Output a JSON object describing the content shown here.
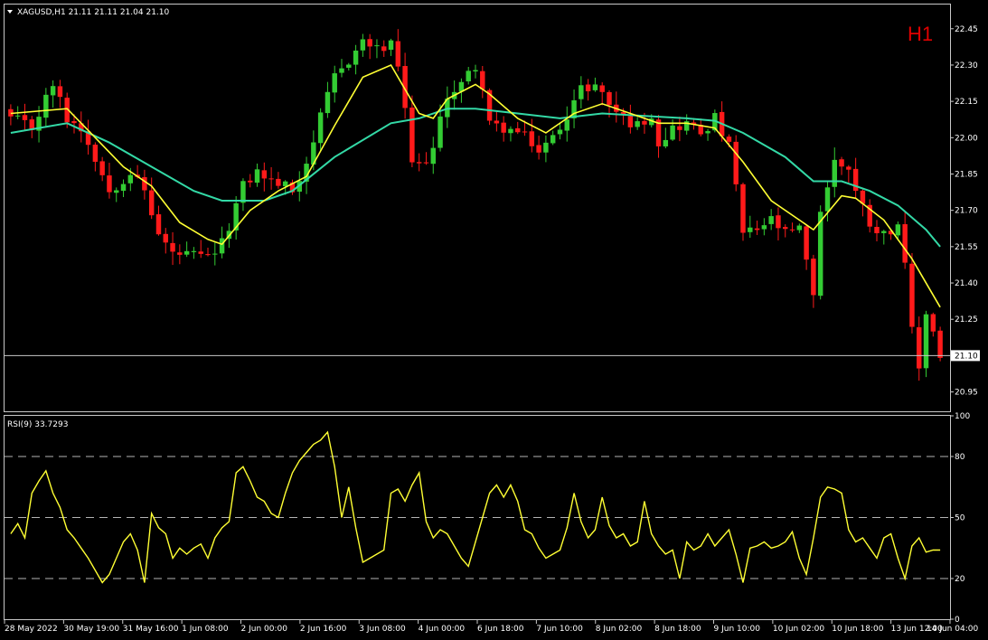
{
  "header": {
    "symbol_info": "XAGUSD,H1  21.11 21.11 21.04 21.10",
    "timeframe": "H1",
    "rsi_label": "RSI(9) 33.7293"
  },
  "colors": {
    "background": "#000000",
    "frame": "#c8c8c8",
    "bull_candle": "#33cc33",
    "bear_candle": "#ff1a1a",
    "ma_fast": "#ffff33",
    "ma_slow": "#33d9a6",
    "rsi": "#ffff33",
    "timeframe_label": "#e00000"
  },
  "price_tag": "21.10",
  "chart_data": [
    {
      "type": "candlestick",
      "title": "XAGUSD,H1",
      "ylim": [
        20.87,
        22.55
      ],
      "y_ticks": [
        "22.45",
        "22.30",
        "22.15",
        "22.00",
        "21.85",
        "21.70",
        "21.55",
        "21.40",
        "21.25",
        "21.10",
        "20.95"
      ],
      "x_ticks": [
        "28 May 2022",
        "30 May 19:00",
        "31 May 16:00",
        "1 Jun 08:00",
        "2 Jun 00:00",
        "2 Jun 16:00",
        "3 Jun 08:00",
        "4 Jun 00:00",
        "6 Jun 18:00",
        "7 Jun 10:00",
        "8 Jun 02:00",
        "8 Jun 18:00",
        "9 Jun 10:00",
        "10 Jun 02:00",
        "10 Jun 18:00",
        "13 Jun 12:00",
        "14 Jun 04:00"
      ],
      "last_price": 21.1,
      "close_path": [
        [
          0,
          22.08
        ],
        [
          3,
          22.04
        ],
        [
          6,
          22.22
        ],
        [
          8,
          22.08
        ],
        [
          10,
          22.04
        ],
        [
          12,
          21.92
        ],
        [
          14,
          21.78
        ],
        [
          17,
          21.86
        ],
        [
          19,
          21.78
        ],
        [
          21,
          21.6
        ],
        [
          23,
          21.52
        ],
        [
          26,
          21.51
        ],
        [
          28,
          21.5
        ],
        [
          30,
          21.56
        ],
        [
          33,
          21.8
        ],
        [
          35,
          21.86
        ],
        [
          37,
          21.82
        ],
        [
          39,
          21.8
        ],
        [
          40,
          21.78
        ],
        [
          42,
          21.9
        ],
        [
          44,
          22.08
        ],
        [
          46,
          22.25
        ],
        [
          48,
          22.32
        ],
        [
          50,
          22.4
        ],
        [
          52,
          22.36
        ],
        [
          54,
          22.38
        ],
        [
          55,
          22.3
        ],
        [
          56,
          22.1
        ],
        [
          57,
          21.9
        ],
        [
          58,
          21.88
        ],
        [
          60,
          21.95
        ],
        [
          62,
          22.18
        ],
        [
          64,
          22.22
        ],
        [
          66,
          22.3
        ],
        [
          67,
          22.2
        ],
        [
          68,
          22.05
        ],
        [
          70,
          22.04
        ],
        [
          72,
          22.02
        ],
        [
          74,
          21.98
        ],
        [
          75,
          21.94
        ],
        [
          77,
          22.0
        ],
        [
          79,
          22.1
        ],
        [
          81,
          22.2
        ],
        [
          83,
          22.22
        ],
        [
          85,
          22.14
        ],
        [
          87,
          22.08
        ],
        [
          89,
          22.05
        ],
        [
          91,
          22.1
        ],
        [
          92,
          21.98
        ],
        [
          94,
          22.04
        ],
        [
          96,
          22.06
        ],
        [
          98,
          22.02
        ],
        [
          100,
          22.08
        ],
        [
          102,
          21.96
        ],
        [
          103,
          21.8
        ],
        [
          104,
          21.6
        ],
        [
          106,
          21.62
        ],
        [
          108,
          21.66
        ],
        [
          110,
          21.6
        ],
        [
          112,
          21.62
        ],
        [
          113,
          21.48
        ],
        [
          114,
          21.36
        ],
        [
          115,
          21.7
        ],
        [
          117,
          21.9
        ],
        [
          119,
          21.88
        ],
        [
          120,
          21.78
        ],
        [
          122,
          21.65
        ],
        [
          124,
          21.6
        ],
        [
          126,
          21.65
        ],
        [
          127,
          21.46
        ],
        [
          128,
          21.2
        ],
        [
          129,
          21.05
        ],
        [
          130,
          21.28
        ],
        [
          131,
          21.2
        ],
        [
          132,
          21.1
        ]
      ],
      "ma_fast": [
        [
          0,
          22.1
        ],
        [
          8,
          22.12
        ],
        [
          12,
          22.0
        ],
        [
          16,
          21.88
        ],
        [
          20,
          21.8
        ],
        [
          24,
          21.65
        ],
        [
          28,
          21.58
        ],
        [
          30,
          21.56
        ],
        [
          34,
          21.7
        ],
        [
          38,
          21.78
        ],
        [
          42,
          21.84
        ],
        [
          46,
          22.05
        ],
        [
          50,
          22.25
        ],
        [
          54,
          22.3
        ],
        [
          56,
          22.2
        ],
        [
          58,
          22.1
        ],
        [
          60,
          22.08
        ],
        [
          62,
          22.16
        ],
        [
          66,
          22.22
        ],
        [
          68,
          22.18
        ],
        [
          72,
          22.08
        ],
        [
          76,
          22.02
        ],
        [
          80,
          22.1
        ],
        [
          84,
          22.14
        ],
        [
          88,
          22.1
        ],
        [
          92,
          22.06
        ],
        [
          96,
          22.06
        ],
        [
          100,
          22.04
        ],
        [
          104,
          21.9
        ],
        [
          108,
          21.74
        ],
        [
          112,
          21.66
        ],
        [
          114,
          21.62
        ],
        [
          118,
          21.76
        ],
        [
          120,
          21.75
        ],
        [
          124,
          21.66
        ],
        [
          128,
          21.5
        ],
        [
          132,
          21.3
        ]
      ],
      "ma_slow": [
        [
          0,
          22.02
        ],
        [
          8,
          22.06
        ],
        [
          14,
          21.98
        ],
        [
          20,
          21.88
        ],
        [
          26,
          21.78
        ],
        [
          30,
          21.74
        ],
        [
          36,
          21.74
        ],
        [
          40,
          21.78
        ],
        [
          46,
          21.92
        ],
        [
          54,
          22.06
        ],
        [
          58,
          22.08
        ],
        [
          62,
          22.12
        ],
        [
          66,
          22.12
        ],
        [
          72,
          22.1
        ],
        [
          78,
          22.08
        ],
        [
          84,
          22.1
        ],
        [
          90,
          22.09
        ],
        [
          96,
          22.08
        ],
        [
          100,
          22.07
        ],
        [
          104,
          22.02
        ],
        [
          110,
          21.92
        ],
        [
          114,
          21.82
        ],
        [
          118,
          21.82
        ],
        [
          122,
          21.78
        ],
        [
          126,
          21.72
        ],
        [
          130,
          21.62
        ],
        [
          132,
          21.55
        ]
      ]
    },
    {
      "type": "line",
      "title": "RSI(9) 33.7293",
      "ylim": [
        0,
        100
      ],
      "y_ticks": [
        100,
        80,
        50,
        20,
        0
      ],
      "levels": [
        80,
        50,
        20
      ],
      "series": [
        {
          "name": "RSI(9)",
          "values": [
            [
              0,
              42
            ],
            [
              1,
              47
            ],
            [
              2,
              40
            ],
            [
              3,
              62
            ],
            [
              4,
              68
            ],
            [
              5,
              73
            ],
            [
              6,
              62
            ],
            [
              7,
              55
            ],
            [
              8,
              44
            ],
            [
              9,
              40
            ],
            [
              10,
              35
            ],
            [
              11,
              30
            ],
            [
              12,
              24
            ],
            [
              13,
              18
            ],
            [
              14,
              22
            ],
            [
              15,
              30
            ],
            [
              16,
              38
            ],
            [
              17,
              42
            ],
            [
              18,
              34
            ],
            [
              19,
              18
            ],
            [
              20,
              52
            ],
            [
              21,
              45
            ],
            [
              22,
              42
            ],
            [
              23,
              30
            ],
            [
              24,
              35
            ],
            [
              25,
              32
            ],
            [
              26,
              35
            ],
            [
              27,
              37
            ],
            [
              28,
              30
            ],
            [
              29,
              40
            ],
            [
              30,
              45
            ],
            [
              31,
              48
            ],
            [
              32,
              72
            ],
            [
              33,
              75
            ],
            [
              34,
              68
            ],
            [
              35,
              60
            ],
            [
              36,
              58
            ],
            [
              37,
              52
            ],
            [
              38,
              50
            ],
            [
              39,
              62
            ],
            [
              40,
              72
            ],
            [
              41,
              78
            ],
            [
              42,
              82
            ],
            [
              43,
              86
            ],
            [
              44,
              88
            ],
            [
              45,
              92
            ],
            [
              46,
              75
            ],
            [
              47,
              50
            ],
            [
              48,
              65
            ],
            [
              49,
              45
            ],
            [
              50,
              28
            ],
            [
              51,
              30
            ],
            [
              52,
              32
            ],
            [
              53,
              34
            ],
            [
              54,
              62
            ],
            [
              55,
              64
            ],
            [
              56,
              58
            ],
            [
              57,
              66
            ],
            [
              58,
              72
            ],
            [
              59,
              48
            ],
            [
              60,
              40
            ],
            [
              61,
              44
            ],
            [
              62,
              42
            ],
            [
              63,
              36
            ],
            [
              64,
              30
            ],
            [
              65,
              26
            ],
            [
              66,
              38
            ],
            [
              67,
              50
            ],
            [
              68,
              62
            ],
            [
              69,
              66
            ],
            [
              70,
              60
            ],
            [
              71,
              66
            ],
            [
              72,
              58
            ],
            [
              73,
              44
            ],
            [
              74,
              42
            ],
            [
              75,
              35
            ],
            [
              76,
              30
            ],
            [
              77,
              32
            ],
            [
              78,
              34
            ],
            [
              79,
              45
            ],
            [
              80,
              62
            ],
            [
              81,
              48
            ],
            [
              82,
              40
            ],
            [
              83,
              44
            ],
            [
              84,
              60
            ],
            [
              85,
              46
            ],
            [
              86,
              40
            ],
            [
              87,
              42
            ],
            [
              88,
              36
            ],
            [
              89,
              38
            ],
            [
              90,
              58
            ],
            [
              91,
              42
            ],
            [
              92,
              36
            ],
            [
              93,
              32
            ],
            [
              94,
              34
            ],
            [
              95,
              20
            ],
            [
              96,
              38
            ],
            [
              97,
              34
            ],
            [
              98,
              36
            ],
            [
              99,
              42
            ],
            [
              100,
              36
            ],
            [
              101,
              40
            ],
            [
              102,
              44
            ],
            [
              103,
              32
            ],
            [
              104,
              18
            ],
            [
              105,
              35
            ],
            [
              106,
              36
            ],
            [
              107,
              38
            ],
            [
              108,
              35
            ],
            [
              109,
              36
            ],
            [
              110,
              38
            ],
            [
              111,
              43
            ],
            [
              112,
              30
            ],
            [
              113,
              22
            ],
            [
              114,
              40
            ],
            [
              115,
              60
            ],
            [
              116,
              65
            ],
            [
              117,
              64
            ],
            [
              118,
              62
            ],
            [
              119,
              44
            ],
            [
              120,
              38
            ],
            [
              121,
              40
            ],
            [
              122,
              35
            ],
            [
              123,
              30
            ],
            [
              124,
              40
            ],
            [
              125,
              42
            ],
            [
              126,
              30
            ],
            [
              127,
              20
            ],
            [
              128,
              36
            ],
            [
              129,
              40
            ],
            [
              130,
              33
            ],
            [
              131,
              34
            ],
            [
              132,
              34
            ]
          ]
        }
      ]
    }
  ]
}
